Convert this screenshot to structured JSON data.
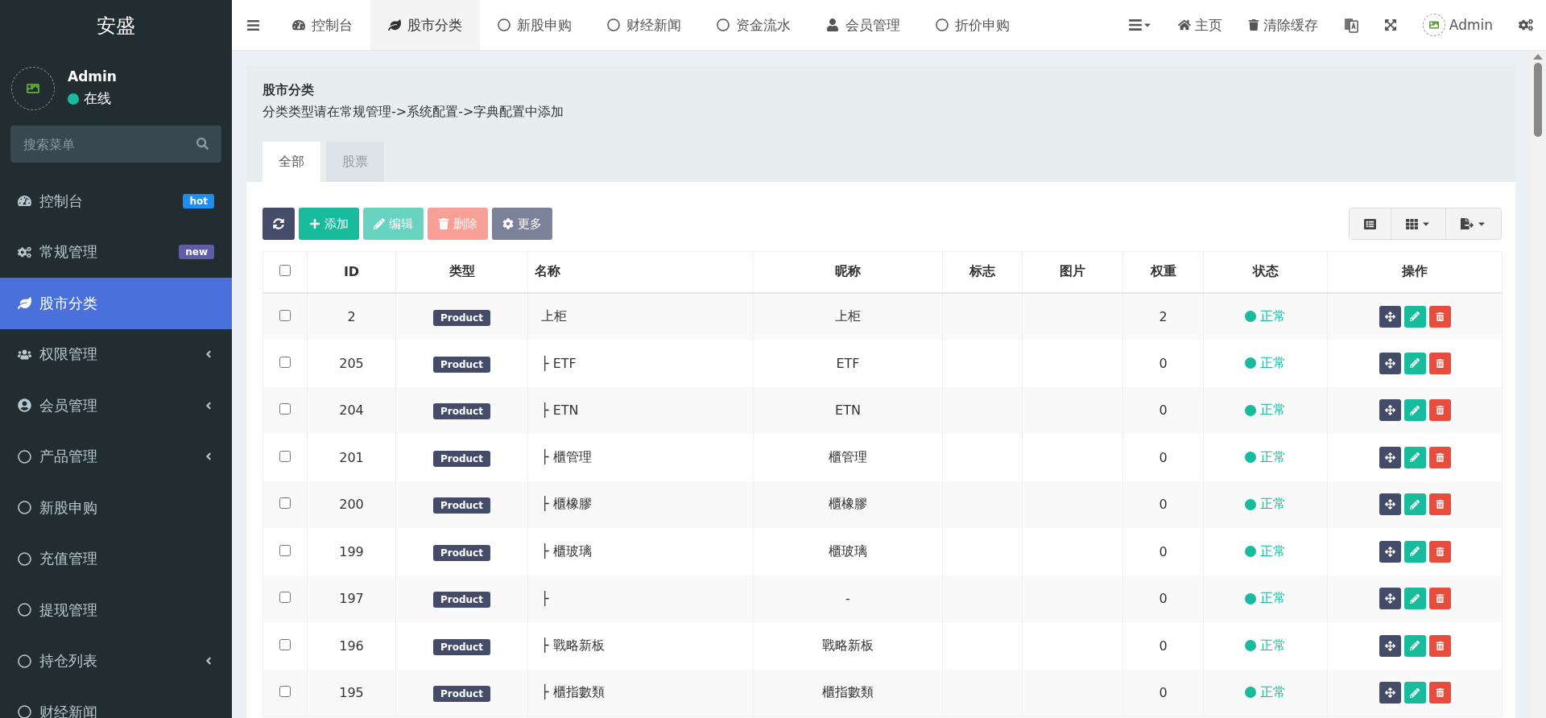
{
  "sidebar": {
    "brand": "安盛",
    "user": {
      "name": "Admin",
      "status": "在线",
      "online": true
    },
    "search": {
      "placeholder": "搜索菜单"
    },
    "items": [
      {
        "label": "控制台",
        "selected": false,
        "has_children": false,
        "badge": {
          "text": "hot",
          "color": "#1e8ff2"
        }
      },
      {
        "label": "常规管理",
        "selected": false,
        "has_children": false,
        "badge": {
          "text": "new",
          "color": "#605ca8"
        }
      },
      {
        "label": "股市分类",
        "selected": true,
        "has_children": false
      },
      {
        "label": "权限管理",
        "selected": false,
        "has_children": true
      },
      {
        "label": "会员管理",
        "selected": false,
        "has_children": true
      },
      {
        "label": "产品管理",
        "selected": false,
        "has_children": true
      },
      {
        "label": "新股申购",
        "selected": false,
        "has_children": false
      },
      {
        "label": "充值管理",
        "selected": false,
        "has_children": false
      },
      {
        "label": "提现管理",
        "selected": false,
        "has_children": false
      },
      {
        "label": "持仓列表",
        "selected": false,
        "has_children": true
      },
      {
        "label": "财经新闻",
        "selected": false,
        "has_children": false
      }
    ]
  },
  "topbar": {
    "tabs": [
      {
        "label": "控制台",
        "selected": false
      },
      {
        "label": "股市分类",
        "selected": true
      },
      {
        "label": "新股申购",
        "selected": false
      },
      {
        "label": "财经新闻",
        "selected": false
      },
      {
        "label": "资金流水",
        "selected": false
      },
      {
        "label": "会员管理",
        "selected": false
      },
      {
        "label": "折价申购",
        "selected": false
      }
    ],
    "links": [
      "主页",
      "清除缓存"
    ],
    "user": "Admin"
  },
  "panel": {
    "title": "股市分类",
    "description": "分类类型请在常规管理->系统配置->字典配置中添加",
    "tabs": [
      {
        "label": "全部",
        "selected": true
      },
      {
        "label": "股票",
        "selected": false
      }
    ],
    "toolbar": [
      {
        "kind": "refresh",
        "disabled": false
      },
      {
        "kind": "add",
        "label": "添加",
        "disabled": false
      },
      {
        "kind": "edit",
        "label": "编辑",
        "disabled": true
      },
      {
        "kind": "delete",
        "label": "删除",
        "disabled": true
      },
      {
        "kind": "more",
        "label": "更多",
        "disabled": false
      }
    ],
    "table": {
      "columns": [
        "ID",
        "类型",
        "名称",
        "昵称",
        "标志",
        "图片",
        "权重",
        "状态",
        "操作"
      ],
      "all_checked": false,
      "rows": [
        {
          "checked": false,
          "id": "2",
          "type": "Product",
          "name": "上柜",
          "nickname": "上柜",
          "weight": "2",
          "status": "正常",
          "active": true
        },
        {
          "checked": false,
          "id": "205",
          "type": "Product",
          "name": "├ ETF",
          "nickname": "ETF",
          "weight": "0",
          "status": "正常",
          "active": true
        },
        {
          "checked": false,
          "id": "204",
          "type": "Product",
          "name": "├ ETN",
          "nickname": "ETN",
          "weight": "0",
          "status": "正常",
          "active": true
        },
        {
          "checked": false,
          "id": "201",
          "type": "Product",
          "name": "├ 櫃管理",
          "nickname": "櫃管理",
          "weight": "0",
          "status": "正常",
          "active": true
        },
        {
          "checked": false,
          "id": "200",
          "type": "Product",
          "name": "├ 櫃橡膠",
          "nickname": "櫃橡膠",
          "weight": "0",
          "status": "正常",
          "active": true
        },
        {
          "checked": false,
          "id": "199",
          "type": "Product",
          "name": "├ 櫃玻璃",
          "nickname": "櫃玻璃",
          "weight": "0",
          "status": "正常",
          "active": true
        },
        {
          "checked": false,
          "id": "197",
          "type": "Product",
          "name": "├",
          "nickname": "-",
          "weight": "0",
          "status": "正常",
          "active": true
        },
        {
          "checked": false,
          "id": "196",
          "type": "Product",
          "name": "├ 戰略新板",
          "nickname": "戰略新板",
          "weight": "0",
          "status": "正常",
          "active": true
        },
        {
          "checked": false,
          "id": "195",
          "type": "Product",
          "name": "├ 櫃指數類",
          "nickname": "櫃指數類",
          "weight": "0",
          "status": "正常",
          "active": true
        }
      ]
    }
  }
}
